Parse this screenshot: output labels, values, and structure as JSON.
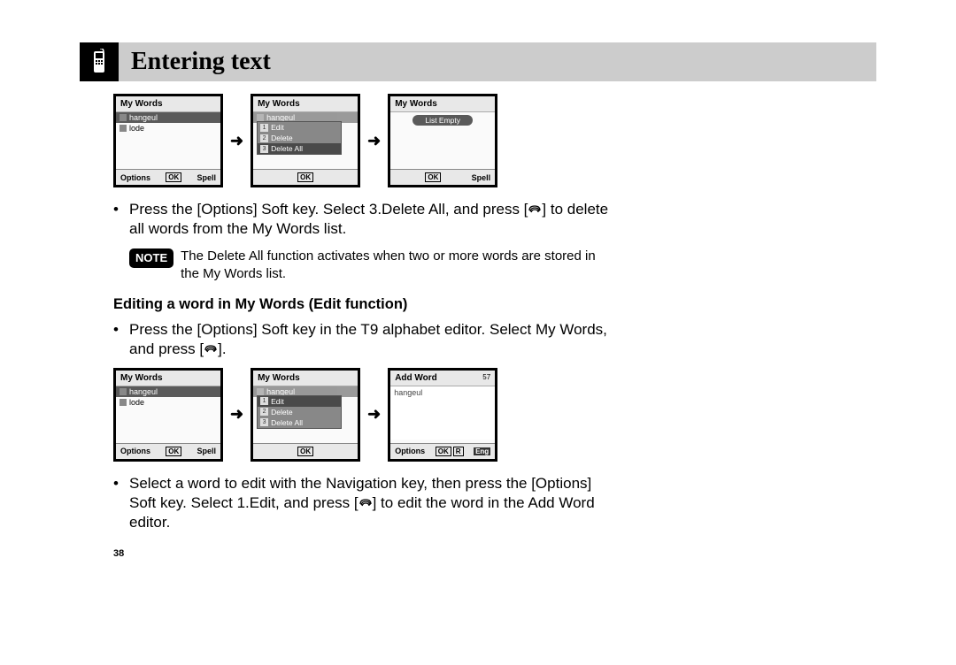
{
  "header": {
    "title": "Entering text"
  },
  "screens": {
    "row1": {
      "s1": {
        "title": "My Words",
        "items": [
          {
            "label": "hangeul",
            "hl": true
          },
          {
            "label": "lode",
            "hl": false
          }
        ],
        "foot_left": "Options",
        "ok": "OK",
        "foot_right": "Spell"
      },
      "s2": {
        "title": "My Words",
        "bg_item": "hangeul",
        "menu": [
          {
            "n": "1",
            "label": "Edit",
            "hl": false
          },
          {
            "n": "2",
            "label": "Delete",
            "hl": false
          },
          {
            "n": "3",
            "label": "Delete All",
            "hl": true
          }
        ],
        "ok": "OK"
      },
      "s3": {
        "title": "My Words",
        "empty": "List Empty",
        "ok": "OK",
        "foot_right": "Spell"
      }
    },
    "row2": {
      "s1": {
        "title": "My Words",
        "items": [
          {
            "label": "hangeul",
            "hl": true
          },
          {
            "label": "lode",
            "hl": false
          }
        ],
        "foot_left": "Options",
        "ok": "OK",
        "foot_right": "Spell"
      },
      "s2": {
        "title": "My Words",
        "bg_item": "hangeul",
        "menu": [
          {
            "n": "1",
            "label": "Edit",
            "hl": true
          },
          {
            "n": "2",
            "label": "Delete",
            "hl": false
          },
          {
            "n": "3",
            "label": "Delete All",
            "hl": false
          }
        ],
        "ok": "OK"
      },
      "s3": {
        "title": "Add Word",
        "title_right": "57",
        "text": "hangeul",
        "foot_left": "Options",
        "ok": "OK",
        "r": "R",
        "eng": "Eng"
      }
    }
  },
  "para1a": "Press the [Options] Soft key. Select 3.Delete All, and press [",
  "para1b": "] to delete all words from the My Words list.",
  "note_label": "NOTE",
  "note_text": "The Delete All function activates when two or more words are stored in the My Words list.",
  "sub_heading": "Editing a word in My Words (Edit function)",
  "para2a": "Press the [Options] Soft key in the T9 alphabet editor. Select My Words, and press [",
  "para2b": "].",
  "para3a": "Select a word to edit with the Navigation key, then press the [Options] Soft key. Select 1.Edit, and press [",
  "para3b": "] to edit the word in the Add Word editor.",
  "page_number": "38",
  "arrow": "➜"
}
